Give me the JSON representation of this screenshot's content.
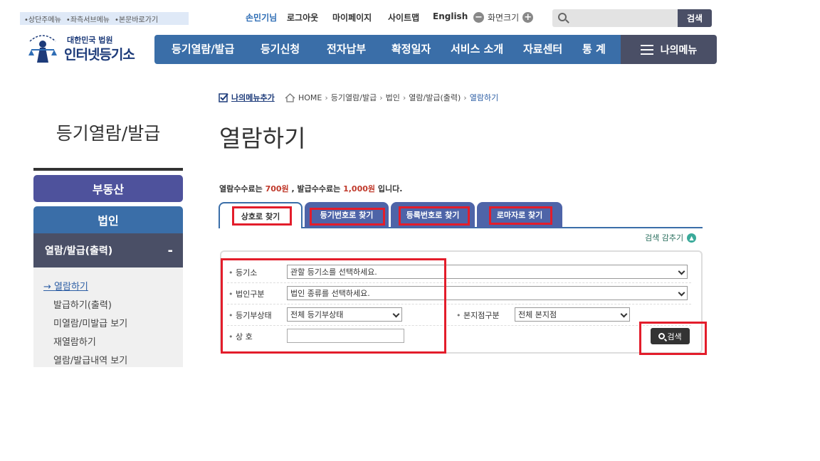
{
  "skip_links": [
    "상단주메뉴",
    "좌측서브메뉴",
    "본문바로가기"
  ],
  "logo": {
    "sub": "대한민국 법원",
    "main": "인터넷등기소"
  },
  "utility": {
    "greeting": "손민기님",
    "logout": "로그아웃",
    "mypage": "마이페이지",
    "sitemap": "사이트맵",
    "english": "English",
    "zoom_label": "화면크기"
  },
  "top_search": {
    "placeholder": "",
    "button": "검색"
  },
  "gnb": [
    "등기열람/발급",
    "등기신청",
    "전자납부",
    "확정일자",
    "서비스 소개",
    "자료센터",
    "통 계"
  ],
  "my_menu": "나의메뉴",
  "lnb": {
    "title": "등기열람/발급",
    "real_estate": "부동산",
    "corporation": "법인",
    "sub_header": "열람/발급(출력)",
    "sub_toggle": "-",
    "items": [
      "열람하기",
      "발급하기(출력)",
      "미열람/미발급 보기",
      "재열람하기",
      "열람/발급내역 보기"
    ]
  },
  "breadcrumb": {
    "favorite": "나의메뉴추가",
    "home": "HOME",
    "items": [
      "등기열람/발급",
      "법인",
      "열람/발급(출력)",
      "열람하기"
    ]
  },
  "page_title": "열람하기",
  "fee": {
    "prefix": "열람수수료는",
    "view_fee": "700원",
    "mid": ", 발급수수료는",
    "issue_fee": "1,000원",
    "suffix": "입니다."
  },
  "tabs": [
    "상호로 찾기",
    "등기번호로 찾기",
    "등록번호로 찾기",
    "로마자로 찾기"
  ],
  "fold_label": "검색 감추기",
  "form": {
    "registry_label": "등기소",
    "registry_value": "관할 등기소를 선택하세요.",
    "corp_type_label": "법인구분",
    "corp_type_value": "법인 종류를 선택하세요.",
    "status_label": "등기부상태",
    "status_value": "전체 등기부상태",
    "branch_label": "본지점구분",
    "branch_value": "전체 본지점",
    "name_label": "상 호",
    "name_value": "",
    "search_button": "검색"
  },
  "colors": {
    "highlight_box": "#e31d2b",
    "gnb": "#3a6ea8",
    "tab": "#4e64a8"
  }
}
